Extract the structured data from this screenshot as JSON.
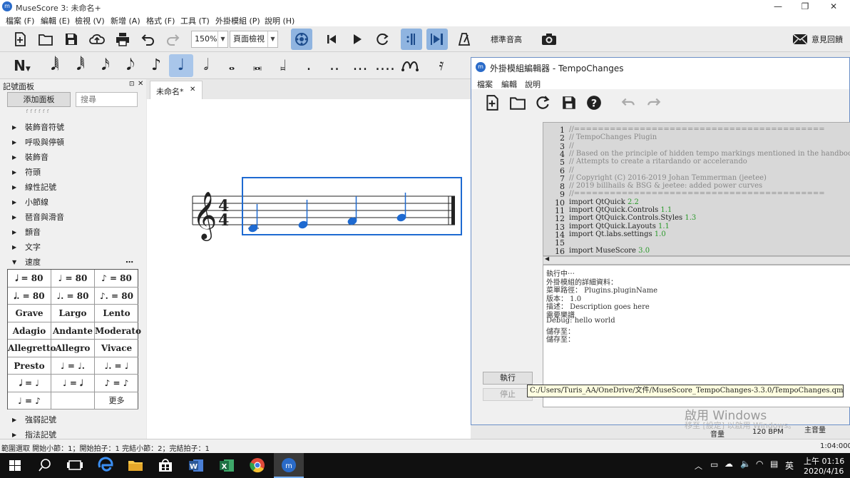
{
  "app": {
    "title": "MuseScore 3: 未命名+",
    "menu": [
      "檔案 (F)",
      "編輯 (E)",
      "檢視 (V)",
      "新增 (A)",
      "格式 (F)",
      "工具 (T)",
      "外掛模組 (P)",
      "說明 (H)"
    ]
  },
  "toolbar": {
    "zoom": "150%",
    "view_mode": "頁面檢視",
    "concert_pitch": "標準音高",
    "feedback": "意見回饋"
  },
  "palette": {
    "title": "記號面板",
    "add_button": "添加面板",
    "search_placeholder": "搜尋",
    "partial_top": "??????",
    "items": [
      "裝飾音符號",
      "呼吸與停頓",
      "裝飾音",
      "符頭",
      "線性記號",
      "小節線",
      "琶音與滑音",
      "顫音",
      "文字"
    ],
    "tempo_label": "速度",
    "tempo_more_dots": "⋯",
    "tempo_cells": [
      "𝅗𝅥 = 80",
      "♩ = 80",
      "♪ = 80",
      "𝅗𝅥. = 80",
      "♩. = 80",
      "♪. = 80",
      "Grave",
      "Largo",
      "Lento",
      "Adagio",
      "Andante",
      "Moderato",
      "Allegretto",
      "Allegro",
      "Vivace",
      "Presto",
      "♩ = ♩.",
      "♩. = ♩",
      "𝅗𝅥 = ♩",
      "♩ = 𝅗𝅥",
      "♪ = ♪",
      "♩ = ♪",
      "",
      "更多"
    ],
    "after_items": [
      "強弱記號",
      "指法記號"
    ]
  },
  "score": {
    "tab_label": "未命名*",
    "tab_close": "✕"
  },
  "statusbar": {
    "text": "範圍選取 開始小節：1；開始拍子：1 完結小節：2；完結拍子：1",
    "time": "1:04:000",
    "tempo": "120 BPM",
    "volume": "音量",
    "main_volume": "主音量"
  },
  "plugin": {
    "title": "外掛模組編輯器 - TempoChanges",
    "menu": [
      "檔案",
      "編輯",
      "說明"
    ],
    "code_lines": [
      {
        "n": "1",
        "parts": [
          {
            "t": "//==========================================",
            "c": "cmt"
          }
        ]
      },
      {
        "n": "2",
        "parts": [
          {
            "t": "//  TempoChanges Plugin",
            "c": "cmt"
          }
        ]
      },
      {
        "n": "3",
        "parts": [
          {
            "t": "//",
            "c": "cmt"
          }
        ]
      },
      {
        "n": "4",
        "parts": [
          {
            "t": "//  Based on the principle of hidden tempo markings mentioned in the handbook",
            "c": "cmt"
          }
        ]
      },
      {
        "n": "5",
        "parts": [
          {
            "t": "//  Attempts to create a ritardando or accelerando",
            "c": "cmt"
          }
        ]
      },
      {
        "n": "6",
        "parts": [
          {
            "t": "//",
            "c": "cmt"
          }
        ]
      },
      {
        "n": "7",
        "parts": [
          {
            "t": "//  Copyright (C) 2016-2019 Johan Temmerman (jeetee)",
            "c": "cmt"
          }
        ]
      },
      {
        "n": "8",
        "parts": [
          {
            "t": "//                2019 billhails & BSG & jeetee: added power curves",
            "c": "cmt"
          }
        ]
      },
      {
        "n": "9",
        "parts": [
          {
            "t": "//==========================================",
            "c": "cmt"
          }
        ]
      },
      {
        "n": "10",
        "parts": [
          {
            "t": "import QtQuick ",
            "c": ""
          },
          {
            "t": "2.2",
            "c": "num"
          }
        ]
      },
      {
        "n": "11",
        "parts": [
          {
            "t": "import QtQuick.Controls ",
            "c": ""
          },
          {
            "t": "1.1",
            "c": "num"
          }
        ]
      },
      {
        "n": "12",
        "parts": [
          {
            "t": "import QtQuick.Controls.Styles ",
            "c": ""
          },
          {
            "t": "1.3",
            "c": "num"
          }
        ]
      },
      {
        "n": "13",
        "parts": [
          {
            "t": "import QtQuick.Layouts ",
            "c": ""
          },
          {
            "t": "1.1",
            "c": "num"
          }
        ]
      },
      {
        "n": "14",
        "parts": [
          {
            "t": "import Qt.labs.settings ",
            "c": ""
          },
          {
            "t": "1.0",
            "c": "num"
          }
        ]
      },
      {
        "n": "15",
        "parts": []
      },
      {
        "n": "16",
        "parts": [
          {
            "t": "import MuseScore ",
            "c": ""
          },
          {
            "t": "3.0",
            "c": "num"
          }
        ]
      }
    ],
    "console_lines": [
      "執行中⋯",
      "外掛模組的詳細資料：",
      "  菜單路徑：  Plugins.pluginName",
      "  版本：  1.0",
      "  描述：  Description goes here",
      "  需要樂譜",
      "Debug: hello world",
      "儲存至：",
      "儲存至："
    ],
    "run_button": "執行",
    "stop_button": "停止",
    "tooltip": "C:/Users/Turis_AA/OneDrive/文件/MuseScore_TempoChanges-3.3.0/TempoChanges.qml"
  },
  "watermark": {
    "line1": "啟用 Windows",
    "line2": "移至 [設定] 以啟用 Windows。"
  },
  "taskbar": {
    "ime": "英",
    "time": "上午 01:16",
    "date": "2020/4/16"
  }
}
